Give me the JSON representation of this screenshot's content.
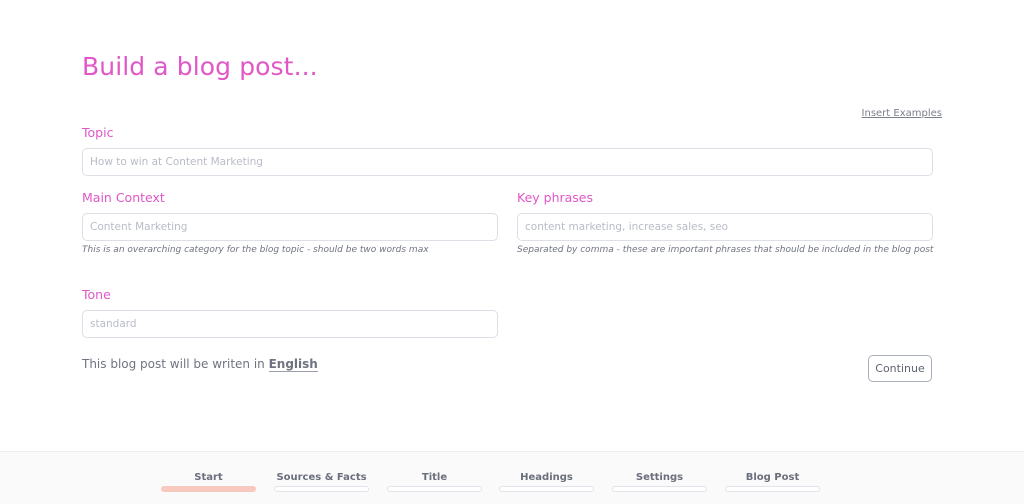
{
  "page": {
    "title": "Build a blog post...",
    "insert_examples": "Insert Examples"
  },
  "form": {
    "topic": {
      "label": "Topic",
      "placeholder": "How to win at Content Marketing",
      "value": ""
    },
    "main_context": {
      "label": "Main Context",
      "placeholder": "Content Marketing",
      "value": "",
      "hint": "This is an overarching category for the blog topic - should be two words max"
    },
    "key_phrases": {
      "label": "Key phrases",
      "placeholder": "content marketing, increase sales, seo",
      "value": "",
      "hint": "Separated by comma - these are important phrases that should be included in the blog post"
    },
    "tone": {
      "label": "Tone",
      "placeholder": "standard",
      "value": ""
    }
  },
  "language": {
    "prefix": "This blog post will be writen in",
    "value": "English"
  },
  "actions": {
    "continue_label": "Continue"
  },
  "steps": [
    {
      "label": "Start",
      "active": true
    },
    {
      "label": "Sources & Facts",
      "active": false
    },
    {
      "label": "Title",
      "active": false
    },
    {
      "label": "Headings",
      "active": false
    },
    {
      "label": "Settings",
      "active": false
    },
    {
      "label": "Blog Post",
      "active": false
    }
  ],
  "colors": {
    "accent": "#e157c8",
    "step_active": "#f8c9bf",
    "text": "#5f6473"
  }
}
